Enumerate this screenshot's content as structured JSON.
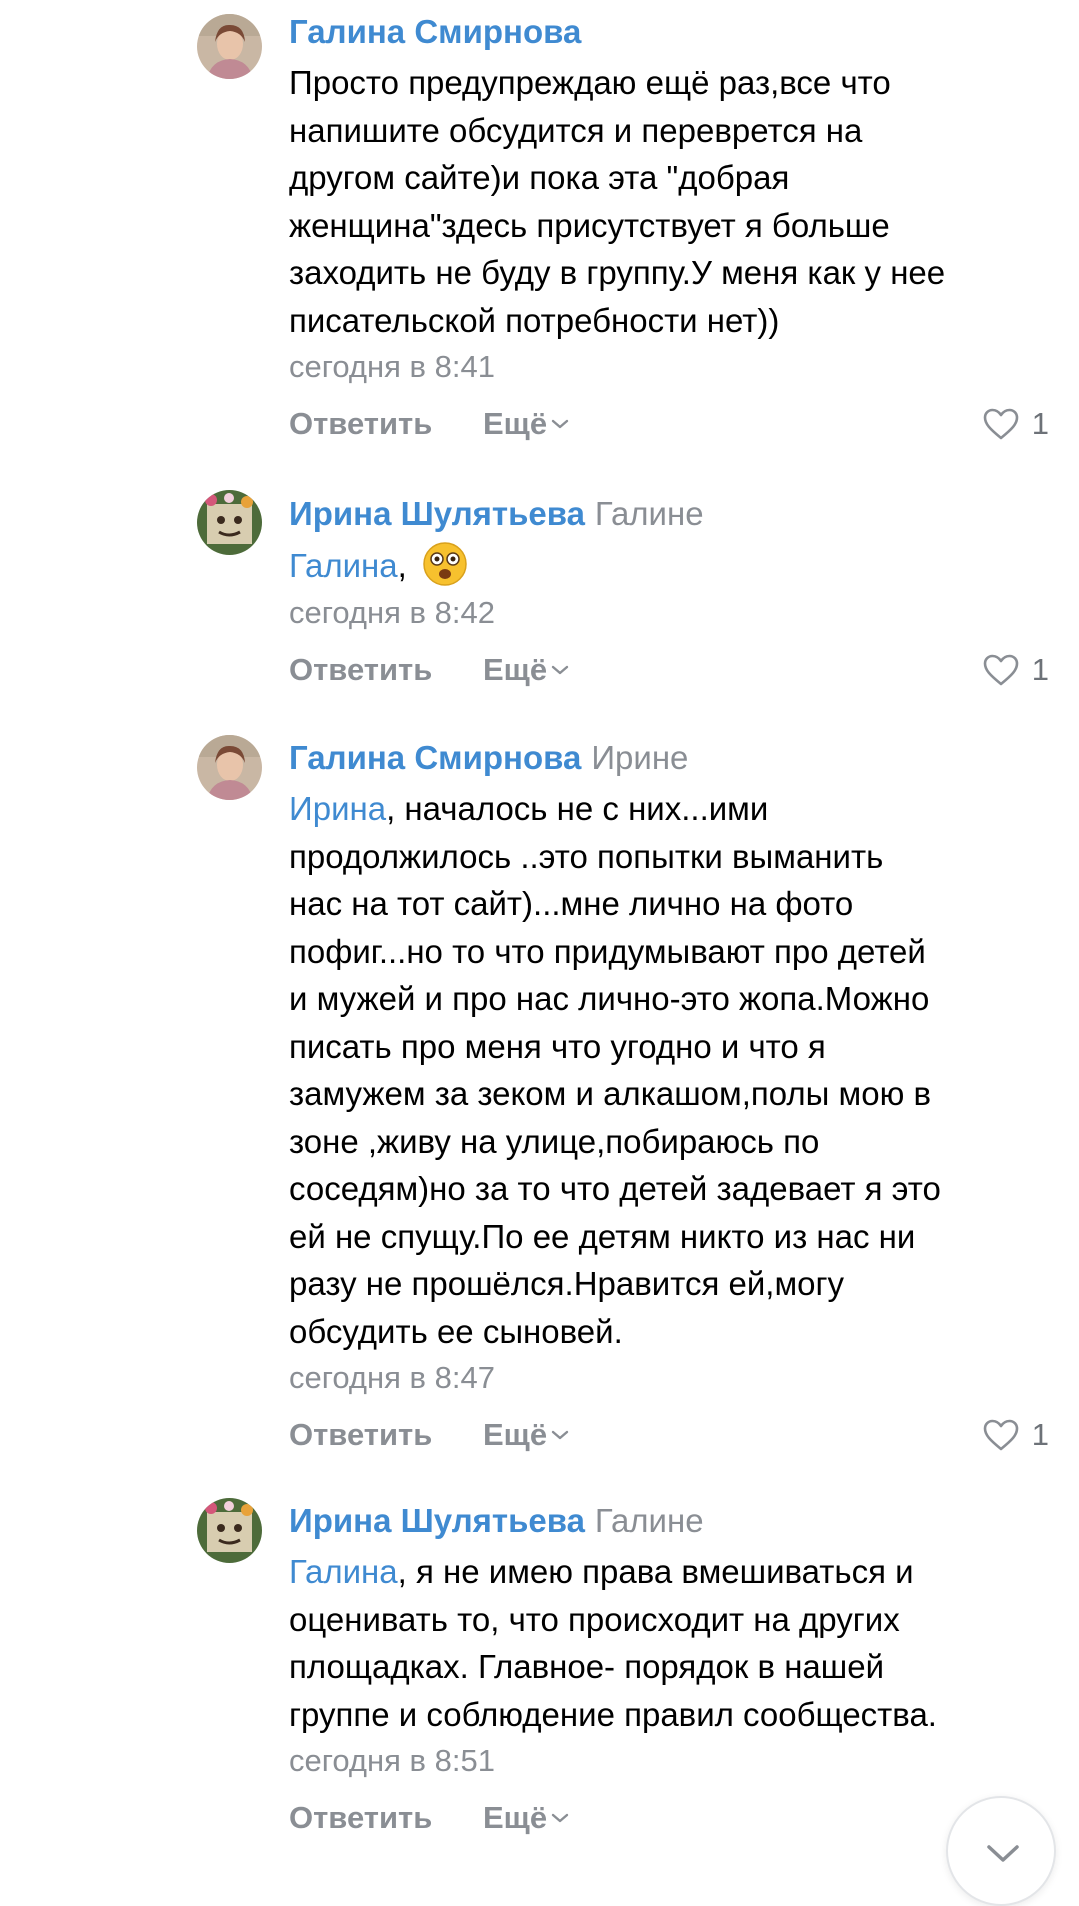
{
  "comments": [
    {
      "author": "Галина Смирнова",
      "reply_to": "",
      "mention": "",
      "text": "Просто предупреждаю ещё раз,все что\nнапишите обсудится и переврется на\nдругом сайте)и пока эта \"добрая\nженщина\"здесь присутствует я больше\nзаходить не буду в группу.У меня как у нее\nписательской потребности нет))",
      "time": "сегодня в 8:41",
      "reply_label": "Ответить",
      "more_label": "Ещё",
      "likes": "1"
    },
    {
      "author": "Ирина Шулятьева",
      "reply_to": "Галине",
      "mention": "Галина",
      "text": ", ",
      "emoji": "astonished-emoji",
      "time": "сегодня в 8:42",
      "reply_label": "Ответить",
      "more_label": "Ещё",
      "likes": "1"
    },
    {
      "author": "Галина Смирнова",
      "reply_to": "Ирине",
      "mention": "Ирина",
      "text": ", началось не с них...ими\nпродолжилось ..это попытки выманить\nнас на тот сайт)...мне лично на фото\nпофиг...но то что придумывают про детей\nи мужей и про нас лично-это жопа.Можно\nписать про меня что угодно и что я\nзамужем за зеком и алкашом,полы мою в\nзоне ,живу на улице,побираюсь по\nсоседям)но за то что детей задевает я это\nей не спущу.По ее детям никто из нас ни\nразу не прошёлся.Нравится ей,могу\nобсудить ее сыновей.",
      "time": "сегодня в 8:47",
      "reply_label": "Ответить",
      "more_label": "Ещё",
      "likes": "1"
    },
    {
      "author": "Ирина Шулятьева",
      "reply_to": "Галине",
      "mention": "Галина",
      "text": ", я не имею права вмешиваться и\nоценивать то, что происходит на других\nплощадках. Главное- порядок в нашей\nгруппе и соблюдение правил сообщества.",
      "time": "сегодня в 8:51",
      "reply_label": "Ответить",
      "more_label": "Ещё",
      "likes": ""
    }
  ],
  "icons": {
    "like": "heart-outline-icon",
    "more": "chevron-down-icon",
    "scroll": "chevron-down-icon"
  },
  "colors": {
    "link": "#3f8ad1",
    "muted": "#8a8e94",
    "text": "#000000"
  }
}
